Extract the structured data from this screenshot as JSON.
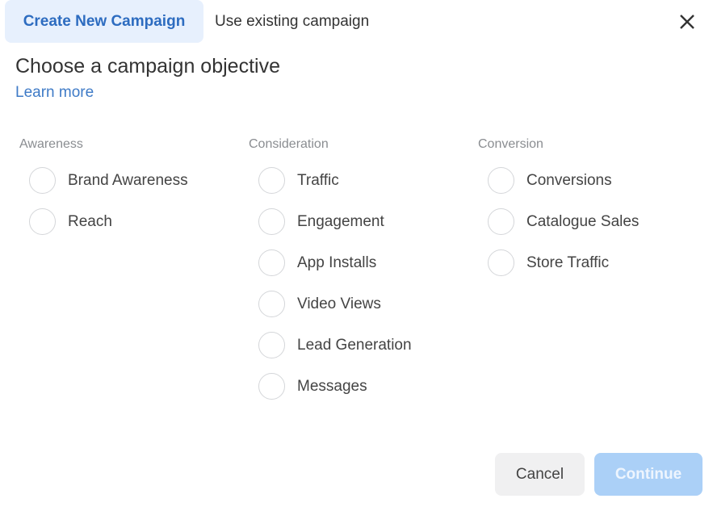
{
  "tabs": [
    {
      "label": "Create New Campaign",
      "active": true
    },
    {
      "label": "Use existing campaign",
      "active": false
    }
  ],
  "close_icon": "close-icon",
  "heading": "Choose a campaign objective",
  "learn_more": "Learn more",
  "columns": [
    {
      "title": "Awareness",
      "options": [
        "Brand Awareness",
        "Reach"
      ]
    },
    {
      "title": "Consideration",
      "options": [
        "Traffic",
        "Engagement",
        "App Installs",
        "Video Views",
        "Lead Generation",
        "Messages"
      ]
    },
    {
      "title": "Conversion",
      "options": [
        "Conversions",
        "Catalogue Sales",
        "Store Traffic"
      ]
    }
  ],
  "buttons": {
    "cancel": "Cancel",
    "continue": "Continue"
  },
  "colors": {
    "accent": "#2d6cc0",
    "active_tab_bg": "#e7f0fd",
    "continue_disabled_bg": "#abd0f7"
  }
}
